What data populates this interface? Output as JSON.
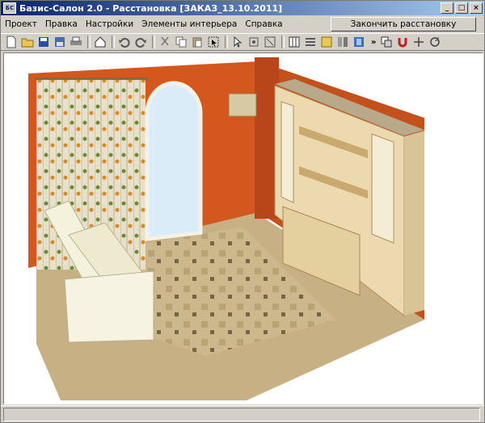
{
  "window": {
    "icon_text": "БС",
    "title": "Базис-Салон 2.0 - Расстановка [ЗАКАЗ_13.10.2011]"
  },
  "title_buttons": {
    "minimize": "_",
    "maximize": "□",
    "close": "×"
  },
  "menu": {
    "items": [
      "Проект",
      "Правка",
      "Настройки",
      "Элементы интерьера",
      "Справка"
    ],
    "finish_button": "Закончить расстановку"
  },
  "toolbar": {
    "icons": [
      "new-document-icon",
      "open-folder-icon",
      "save-icon",
      "save-as-icon",
      "print-icon",
      "home-icon",
      "undo-icon",
      "redo-icon",
      "cut-icon",
      "copy-icon",
      "paste-icon",
      "select-icon",
      "pointer-icon",
      "frame-select-icon",
      "fit-icon",
      "grid-icon",
      "list-icon",
      "catalog-icon",
      "doors-icon",
      "wardrobe-icon",
      "copy-object-icon",
      "magnet-icon",
      "move-icon",
      "rotate-icon"
    ],
    "more": "»"
  },
  "colors": {
    "wall": "#d4581e",
    "wall_dark": "#b8461a",
    "floor": "#c9b487",
    "furniture_wood": "#ecd9b0",
    "sofa": "#f3f0d8",
    "window_glass": "#d9ecf8",
    "titlebar": "#0a246a"
  },
  "status": {
    "text": ""
  }
}
